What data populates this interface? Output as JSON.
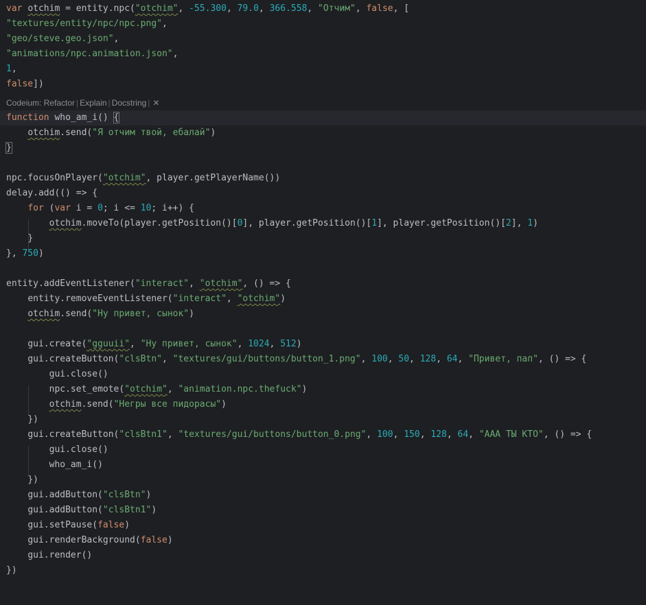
{
  "codelens": {
    "refactor": "Codeium: Refactor",
    "explain": "Explain",
    "docstring": "Docstring",
    "sep": "|",
    "close": "✕"
  },
  "code": {
    "l1_var": "var",
    "l1_name": "otchim",
    "l1_assign": " = entity.npc(",
    "l1_s1": "\"otchim\"",
    "l1_c1": ", ",
    "l1_n1": "-55.300",
    "l1_c2": ", ",
    "l1_n2": "79.0",
    "l1_c3": ", ",
    "l1_n3": "366.558",
    "l1_c4": ", ",
    "l1_s2": "\"Отчим\"",
    "l1_c5": ", ",
    "l1_false": "false",
    "l1_end": ", [",
    "l2": "\"textures/entity/npc/npc.png\"",
    "l2_end": ",",
    "l3": "\"geo/steve.geo.json\"",
    "l3_end": ",",
    "l4": "\"animations/npc.animation.json\"",
    "l4_end": ",",
    "l5": "1",
    "l5_end": ",",
    "l6_false": "false",
    "l6_end": "])",
    "f1_kw": "function",
    "f1_name": " who_am_i() ",
    "f1_brace": "{",
    "f2_obj": "otchim",
    "f2_rest": ".send(",
    "f2_str": "\"Я отчим твой, ебалай\"",
    "f2_end": ")",
    "f3": "}",
    "n1_a": "npc.focusOnPlayer(",
    "n1_s": "\"otchim\"",
    "n1_b": ", player.getPlayerName())",
    "d1": "delay.add(() => {",
    "d2_kw1": "for",
    "d2_a": " (",
    "d2_kw2": "var",
    "d2_b": " i = ",
    "d2_n1": "0",
    "d2_c": "; i <= ",
    "d2_n2": "10",
    "d2_d": "; i++) {",
    "d3_obj": "otchim",
    "d3_a": ".moveTo(player.getPosition()[",
    "d3_n1": "0",
    "d3_b": "], player.getPosition()[",
    "d3_n2": "1",
    "d3_c": "], player.getPosition()[",
    "d3_n3": "2",
    "d3_d": "], ",
    "d3_n4": "1",
    "d3_e": ")",
    "d4": "}",
    "d5_a": "}, ",
    "d5_n": "750",
    "d5_b": ")",
    "e1_a": "entity.addEventListener(",
    "e1_s1": "\"interact\"",
    "e1_b": ", ",
    "e1_s2": "\"otchim\"",
    "e1_c": ", () => {",
    "e2_a": "entity.removeEventListener(",
    "e2_s1": "\"interact\"",
    "e2_b": ", ",
    "e2_s2": "\"otchim\"",
    "e2_c": ")",
    "e3_obj": "otchim",
    "e3_a": ".send(",
    "e3_s": "\"Ну привет, сынок\"",
    "e3_b": ")",
    "g1_a": "gui.create(",
    "g1_s1": "\"gguuii\"",
    "g1_b": ", ",
    "g1_s2": "\"Ну привет, сынок\"",
    "g1_c": ", ",
    "g1_n1": "1024",
    "g1_d": ", ",
    "g1_n2": "512",
    "g1_e": ")",
    "b1_a": "gui.createButton(",
    "b1_s1": "\"clsBtn\"",
    "b1_b": ", ",
    "b1_s2": "\"textures/gui/buttons/button_1.png\"",
    "b1_c": ", ",
    "b1_n1": "100",
    "b1_n2": "50",
    "b1_n3": "128",
    "b1_n4": "64",
    "b1_s3": "\"Привет, пап\"",
    "b1_end": ", () => {",
    "b2": "gui.close()",
    "b3_a": "npc.set_emote(",
    "b3_s1": "\"otchim\"",
    "b3_b": ", ",
    "b3_s2": "\"animation.npc.thefuck\"",
    "b3_c": ")",
    "b4_obj": "otchim",
    "b4_a": ".send(",
    "b4_s": "\"Негры все пидорасы\"",
    "b4_b": ")",
    "b5": "})",
    "c1_a": "gui.createButton(",
    "c1_s1": "\"clsBtn1\"",
    "c1_s2": "\"textures/gui/buttons/button_0.png\"",
    "c1_n1": "100",
    "c1_n2": "150",
    "c1_n3": "128",
    "c1_n4": "64",
    "c1_s3": "\"ААА ТЫ КТО\"",
    "c1_end": ", () => {",
    "c2": "gui.close()",
    "c3": "who_am_i()",
    "c4": "})",
    "a1_a": "gui.addButton(",
    "a1_s": "\"clsBtn\"",
    "a1_b": ")",
    "a2_a": "gui.addButton(",
    "a2_s": "\"clsBtn1\"",
    "a2_b": ")",
    "p1_a": "gui.setPause(",
    "p1_f": "false",
    "p1_b": ")",
    "r1_a": "gui.renderBackground(",
    "r1_f": "false",
    "r1_b": ")",
    "r2": "gui.render()",
    "z": "})",
    "comma": ", "
  }
}
